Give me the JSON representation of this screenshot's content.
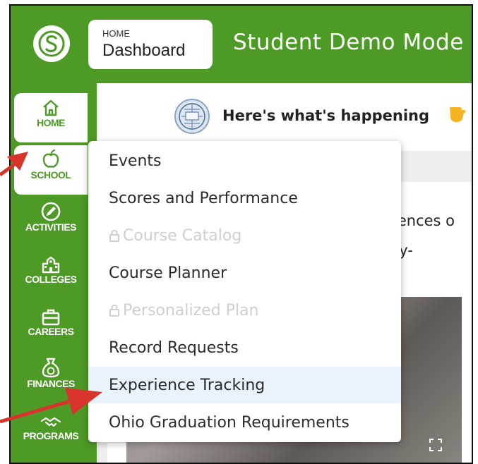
{
  "header": {
    "breadcrumb_small": "HOME",
    "breadcrumb_title": "Dashboard",
    "mode_title": "Student Demo Mode"
  },
  "sidebar": {
    "items": [
      {
        "label": "HOME",
        "icon": "home-icon"
      },
      {
        "label": "SCHOOL",
        "icon": "apple-icon",
        "active": true
      },
      {
        "label": "ACTIVITIES",
        "icon": "pencil-circle-icon"
      },
      {
        "label": "COLLEGES",
        "icon": "school-building-icon"
      },
      {
        "label": "CAREERS",
        "icon": "briefcase-icon"
      },
      {
        "label": "FINANCES",
        "icon": "money-bag-icon"
      },
      {
        "label": "PROGRAMS",
        "icon": "handshake-icon"
      }
    ]
  },
  "main": {
    "happening_text": "Here's what's happening",
    "behind_line1": "iences o",
    "behind_line2": "ty-"
  },
  "school_menu": {
    "items": [
      {
        "label": "Events",
        "locked": false
      },
      {
        "label": "Scores and Performance",
        "locked": false
      },
      {
        "label": "Course Catalog",
        "locked": true
      },
      {
        "label": "Course Planner",
        "locked": false
      },
      {
        "label": "Personalized Plan",
        "locked": true
      },
      {
        "label": "Record Requests",
        "locked": false
      },
      {
        "label": "Experience Tracking",
        "locked": false,
        "highlighted": true
      },
      {
        "label": "Ohio Graduation Requirements",
        "locked": false
      }
    ]
  },
  "colors": {
    "brand_green": "#4e9a26",
    "arrow_red": "#d9342b",
    "highlight": "#e8f3fb"
  }
}
